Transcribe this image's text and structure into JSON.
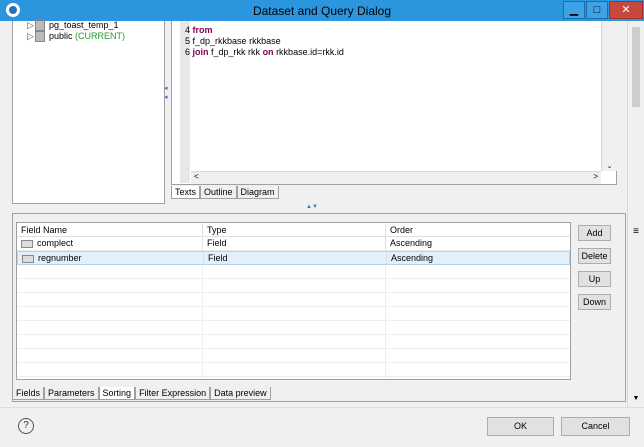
{
  "window": {
    "title": "Dataset and Query Dialog",
    "min": "▁",
    "max": "□",
    "close": "✕"
  },
  "tree": {
    "items": [
      {
        "label": "pg_toast_temp_1",
        "suffix": ""
      },
      {
        "label": "public",
        "suffix": "(CURRENT)"
      }
    ]
  },
  "sql": {
    "lines": [
      {
        "num": "4",
        "parts": [
          {
            "t": "from",
            "kw": true
          }
        ]
      },
      {
        "num": "5",
        "parts": [
          {
            "t": "f_dp_rkkbase rkkbase",
            "kw": false
          }
        ]
      },
      {
        "num": "6",
        "parts": [
          {
            "t": "join",
            "kw": true
          },
          {
            "t": " f_dp_rkk rkk ",
            "kw": false
          },
          {
            "t": "on",
            "kw": true
          },
          {
            "t": " rkkbase.id=rkk.id",
            "kw": false
          }
        ]
      }
    ]
  },
  "editor_tabs": [
    "Texts",
    "Outline",
    "Diagram"
  ],
  "grid": {
    "columns": [
      "Field Name",
      "Type",
      "Order"
    ],
    "rows": [
      [
        "complect",
        "Field",
        "Ascending"
      ],
      [
        "regnumber",
        "Field",
        "Ascending"
      ]
    ]
  },
  "side_buttons": [
    "Add",
    "Delete",
    "Up",
    "Down"
  ],
  "bottom_tabs": [
    "Fields",
    "Parameters",
    "Sorting",
    "Filter Expression",
    "Data preview"
  ],
  "footer": {
    "ok": "OK",
    "cancel": "Cancel",
    "help": "?"
  },
  "colors": {
    "titlebar": "#2b96dd",
    "keyword": "#7f0055",
    "current": "#2a9a2a",
    "selection": "#e3f0fb"
  }
}
